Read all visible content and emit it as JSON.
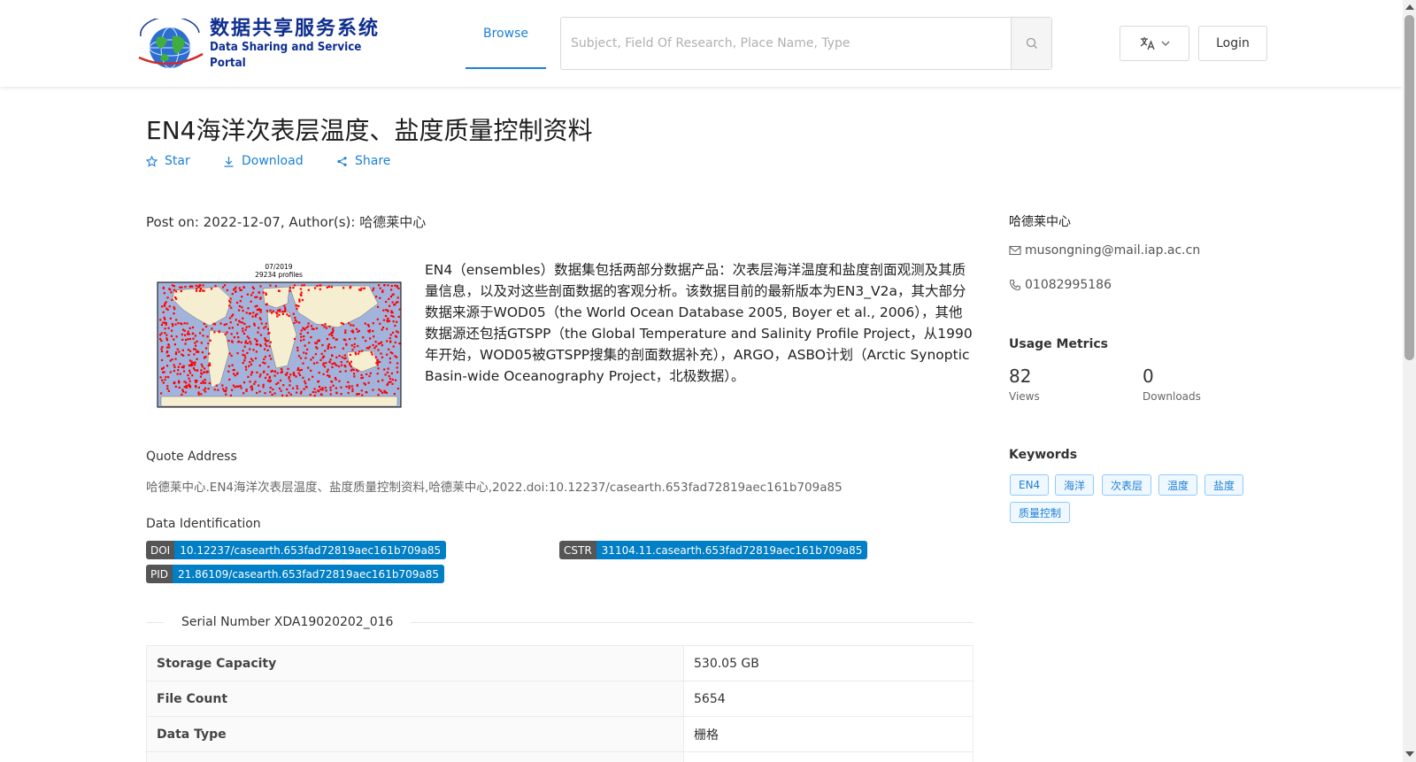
{
  "header": {
    "logo_cn": "数据共享服务系统",
    "logo_en": "Data Sharing and Service Portal",
    "nav_browse": "Browse",
    "search_placeholder": "Subject, Field Of Research, Place Name, Type",
    "login_label": "Login"
  },
  "dataset": {
    "title": "EN4海洋次表层温度、盐度质量控制资料",
    "actions": {
      "star": "Star",
      "download": "Download",
      "share": "Share"
    },
    "post_on": "Post on: 2022-12-07, Author(s): 哈德莱中心",
    "thumbnail": {
      "date": "07/2019",
      "profiles": "29234 profiles"
    },
    "description": "EN4（ensembles）数据集包括两部分数据产品：次表层海洋温度和盐度剖面观测及其质量信息，以及对这些剖面数据的客观分析。该数据目前的最新版本为EN3_V2a，其大部分数据来源于WOD05（the World Ocean Database 2005, Boyer et al., 2006），其他数据源还包括GTSPP（the Global Temperature and Salinity Profile Project，从1990年开始，WOD05被GTSPP搜集的剖面数据补充），ARGO，ASBO计划（Arctic Synoptic Basin-wide Oceanography Project，北极数据）。",
    "quote_label": "Quote Address",
    "quote_text": "哈德莱中心.EN4海洋次表层温度、盐度质量控制资料,哈德莱中心,2022.doi:10.12237/casearth.653fad72819aec161b709a85",
    "identification_label": "Data Identification",
    "identifiers": {
      "doi_key": "DOI",
      "doi_value": "10.12237/casearth.653fad72819aec161b709a85",
      "cstr_key": "CSTR",
      "cstr_value": "31104.11.casearth.653fad72819aec161b709a85",
      "pid_key": "PID",
      "pid_value": "21.86109/casearth.653fad72819aec161b709a85"
    },
    "serial_number": "Serial Number XDA19020202_016",
    "info_table": [
      {
        "key": "Storage Capacity",
        "value": "530.05 GB"
      },
      {
        "key": "File Count",
        "value": "5654"
      },
      {
        "key": "Data Type",
        "value": "栅格"
      }
    ]
  },
  "sidebar": {
    "author": "哈德莱中心",
    "email": "musongning@mail.iap.ac.cn",
    "phone": "01082995186",
    "usage_heading": "Usage Metrics",
    "views_value": "82",
    "views_label": "Views",
    "downloads_value": "0",
    "downloads_label": "Downloads",
    "keywords_heading": "Keywords",
    "keywords": [
      "EN4",
      "海洋",
      "次表层",
      "温度",
      "盐度",
      "质量控制"
    ]
  },
  "colors": {
    "accent": "#1e80d6",
    "badge_key": "#555555",
    "badge_value": "#007ec6",
    "profile_dots": "#ff0000"
  },
  "icons": [
    "globe-logo-icon",
    "search-icon",
    "translate-icon",
    "chevron-down-icon",
    "star-icon",
    "download-icon",
    "share-icon",
    "mail-icon",
    "phone-icon"
  ]
}
